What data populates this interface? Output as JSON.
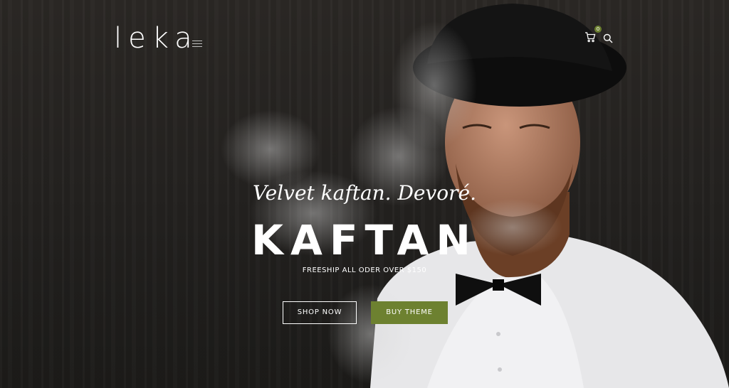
{
  "header": {
    "logo": "leka",
    "menu_icon": "hamburger-icon",
    "cart_icon": "cart-icon",
    "cart_count": "0",
    "search_icon": "search-icon"
  },
  "slide": {
    "subtitle": "Velvet kaftan. Devoré.",
    "title": "KAFTAN",
    "tagline": "FREESHIP ALL ODER OVER $150",
    "primary_button": "SHOP NOW",
    "secondary_button": "BUY THEME"
  },
  "colors": {
    "accent": "#6d8130",
    "background": "#262421",
    "text": "#ffffff"
  }
}
